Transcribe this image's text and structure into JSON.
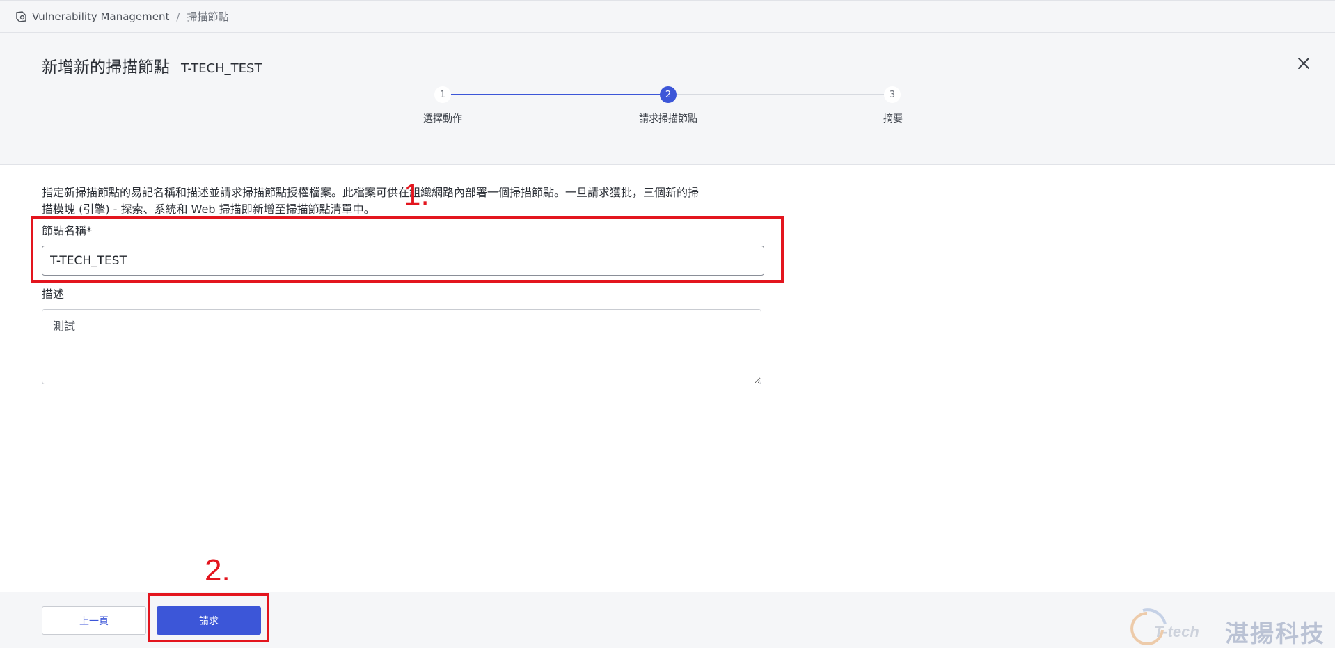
{
  "breadcrumb": {
    "root": "Vulnerability Management",
    "separator": "/",
    "current": "掃描節點"
  },
  "wizard": {
    "title": "新增新的掃描節點",
    "subtitle": "T-TECH_TEST",
    "close_icon": "close-icon",
    "steps": [
      {
        "number": "1",
        "label": "選擇動作",
        "state": "done"
      },
      {
        "number": "2",
        "label": "請求掃描節點",
        "state": "active"
      },
      {
        "number": "3",
        "label": "摘要",
        "state": "pending"
      }
    ],
    "accent_color": "#3c56d8"
  },
  "form": {
    "intro_line1": "指定新掃描節點的易記名稱和描述並請求掃描節點授權檔案。此檔案可供在組織網路內部署一個掃描節點。一旦請求獲批，三個新的掃",
    "intro_line2": "描模塊 (引擎) - 探索、系統和 Web 掃描即新增至掃描節點清單中。",
    "name_label": "節點名稱*",
    "name_value": "T-TECH_TEST",
    "description_label": "描述",
    "description_value": "測試"
  },
  "annotations": {
    "step1": "1.",
    "step2": "2.",
    "color": "#e3151e"
  },
  "footer": {
    "prev_label": "上一頁",
    "request_label": "請求"
  },
  "watermark": {
    "logo_text": "T-tech",
    "company": "湛揚科技"
  }
}
